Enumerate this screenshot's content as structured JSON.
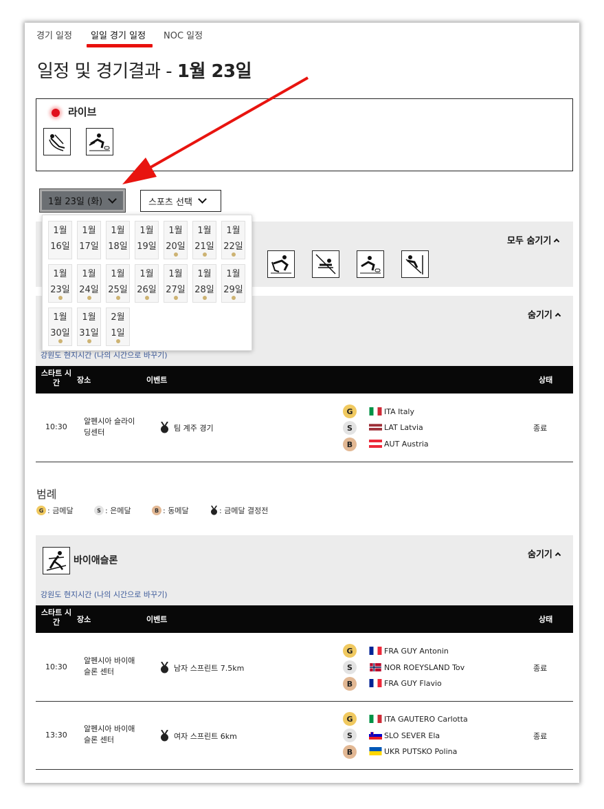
{
  "tabs": [
    "경기 일정",
    "일일 경기 일정",
    "NOC 일정"
  ],
  "title_main": "일정 및 경기결과 - ",
  "title_date": "1월 23일",
  "live": {
    "label": "라이브"
  },
  "date_select": "1월 23일 (화)",
  "sport_select": "스포츠 선택",
  "hide_all": "모두 숨기기",
  "hide": "숨기기",
  "dates": [
    {
      "m": "1월",
      "d": "16일",
      "dot": false
    },
    {
      "m": "1월",
      "d": "17일",
      "dot": false
    },
    {
      "m": "1월",
      "d": "18일",
      "dot": false
    },
    {
      "m": "1월",
      "d": "19일",
      "dot": false
    },
    {
      "m": "1월",
      "d": "20일",
      "dot": true
    },
    {
      "m": "1월",
      "d": "21일",
      "dot": true
    },
    {
      "m": "1월",
      "d": "22일",
      "dot": true
    },
    {
      "m": "1월",
      "d": "23일",
      "dot": true
    },
    {
      "m": "1월",
      "d": "24일",
      "dot": true
    },
    {
      "m": "1월",
      "d": "25일",
      "dot": true
    },
    {
      "m": "1월",
      "d": "26일",
      "dot": true
    },
    {
      "m": "1월",
      "d": "27일",
      "dot": true
    },
    {
      "m": "1월",
      "d": "28일",
      "dot": true
    },
    {
      "m": "1월",
      "d": "29일",
      "dot": true
    },
    {
      "m": "1월",
      "d": "30일",
      "dot": true
    },
    {
      "m": "1월",
      "d": "31일",
      "dot": true
    },
    {
      "m": "2월",
      "d": "1일",
      "dot": true
    }
  ],
  "tz_link": "강원도 현지시간 (나의 시간으로 바꾸기)",
  "table_headers": {
    "start": "스타트 시간",
    "venue": "장소",
    "event": "이벤트",
    "status": "상태"
  },
  "sections": [
    {
      "name": "",
      "rows": [
        {
          "time": "10:30",
          "venue": "알펜시아 슬라이딩센터",
          "event": "팀 계주 경기",
          "medals": [
            {
              "m": "G",
              "country": "ITA Italy",
              "flag": "ITA"
            },
            {
              "m": "S",
              "country": "LAT Latvia",
              "flag": "LAT"
            },
            {
              "m": "B",
              "country": "AUT Austria",
              "flag": "AUT"
            }
          ],
          "status": "종료"
        }
      ]
    },
    {
      "name": "바이애슬론",
      "rows": [
        {
          "time": "10:30",
          "venue": "알펜시아 바이애슬론 센터",
          "event": "남자 스프린트 7.5km",
          "medals": [
            {
              "m": "G",
              "country": "FRA GUY Antonin",
              "flag": "FRA"
            },
            {
              "m": "S",
              "country": "NOR ROEYSLAND Tov",
              "flag": "NOR"
            },
            {
              "m": "B",
              "country": "FRA GUY Flavio",
              "flag": "FRA"
            }
          ],
          "status": "종료"
        },
        {
          "time": "13:30",
          "venue": "알펜시아 바이애슬론 센터",
          "event": "여자 스프린트 6km",
          "medals": [
            {
              "m": "G",
              "country": "ITA GAUTERO Carlotta",
              "flag": "ITA"
            },
            {
              "m": "S",
              "country": "SLO SEVER Ela",
              "flag": "SLO"
            },
            {
              "m": "B",
              "country": "UKR PUTSKO Polina",
              "flag": "UKR"
            }
          ],
          "status": "종료"
        }
      ]
    }
  ],
  "legend": {
    "title": "범례",
    "gold": ": 금메달",
    "silver": ": 은메달",
    "bronze": ": 동메달",
    "final": ": 금메달 결정전"
  },
  "colors": {
    "accent": "#e8100c",
    "gold": "#f0c960",
    "silver": "#e3e3e3",
    "bronze": "#e2b894",
    "header": "#080808"
  }
}
